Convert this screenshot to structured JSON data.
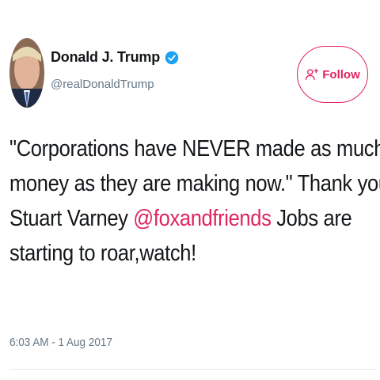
{
  "author": {
    "display_name": "Donald J. Trump",
    "handle": "@realDonaldTrump",
    "verified": true,
    "avatar_icon": "user-avatar"
  },
  "follow_button": {
    "label": "Follow",
    "icon": "add-user-icon",
    "color": "#e0245e"
  },
  "tweet": {
    "text_part1": "\"Corporations have NEVER made as much money as they are making now.\" Thank you Stuart Varney ",
    "mention": "@foxandfriends",
    "text_part2": " Jobs are starting to roar,watch!",
    "line1": "\"Corporations have NEVER made as much",
    "line2": "money as they are making now.\" Thank you",
    "line3_before": "Stuart Varney ",
    "line3_mention": "@foxandfriends",
    "line3_after": " Jobs are",
    "line4": "starting to roar,watch!"
  },
  "timestamp": "6:03 AM - 1 Aug 2017",
  "colors": {
    "mention": "#e0245e",
    "verified": "#1da1f2",
    "secondary_text": "#657786"
  }
}
